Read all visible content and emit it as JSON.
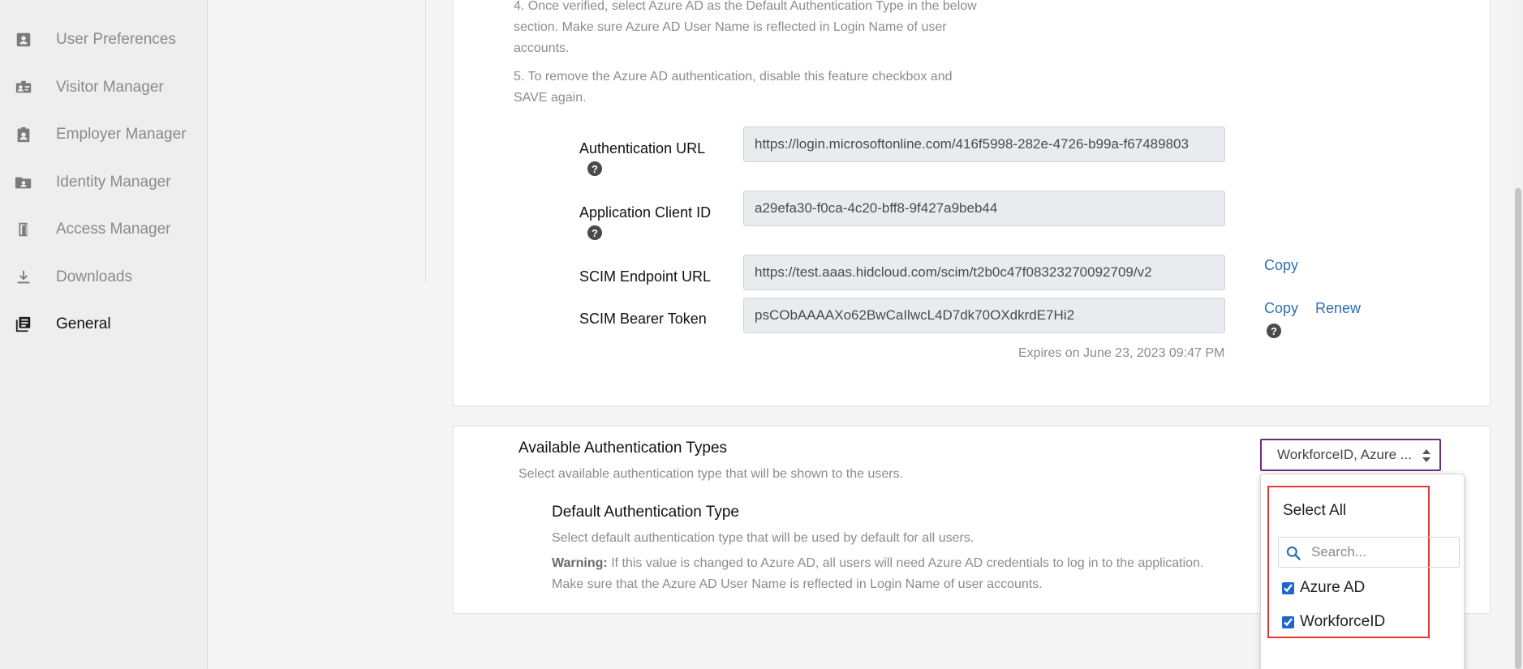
{
  "sidebar": {
    "items": [
      {
        "label": "User Preferences",
        "icon": "user-preferences-icon",
        "active": false
      },
      {
        "label": "Visitor Manager",
        "icon": "visitor-badge-icon",
        "active": false
      },
      {
        "label": "Employer Manager",
        "icon": "employer-badge-icon",
        "active": false
      },
      {
        "label": "Identity Manager",
        "icon": "identity-folder-icon",
        "active": false
      },
      {
        "label": "Access Manager",
        "icon": "door-icon",
        "active": false
      },
      {
        "label": "Downloads",
        "icon": "download-icon",
        "active": false
      },
      {
        "label": "General",
        "icon": "library-icon",
        "active": true
      }
    ]
  },
  "instructions": {
    "step4_line1": "4. Once verified, select Azure AD as the Default Authentication Type in the below",
    "step4_line2": "section. Make sure Azure AD User Name is reflected in Login Name of user",
    "step4_line3": "accounts.",
    "step5_line1": "5. To remove the Azure AD authentication, disable this feature checkbox and",
    "step5_line2": "SAVE again."
  },
  "fields": {
    "auth_url": {
      "label": "Authentication URL",
      "value": "https://login.microsoftonline.com/416f5998-282e-4726-b99a-f67489803"
    },
    "client_id": {
      "label": "Application Client ID",
      "value": "a29efa30-f0ca-4c20-bff8-9f427a9beb44"
    },
    "scim_url": {
      "label": "SCIM Endpoint URL",
      "value": "https://test.aaas.hidcloud.com/scim/t2b0c47f08323270092709/v2",
      "copy_label": "Copy"
    },
    "scim_token": {
      "label": "SCIM Bearer Token",
      "value": "psCObAAAAXo62BwCaIlwcL4D7dk70OXdkrdE7Hi2",
      "copy_label": "Copy",
      "renew_label": "Renew"
    },
    "expires": "Expires on June 23, 2023 09:47 PM",
    "help_glyph": "?"
  },
  "auth_types": {
    "title": "Available Authentication Types",
    "description": "Select available authentication type that will be shown to the users.",
    "selected_value": "WorkforceID, Azure ...",
    "dropdown": {
      "select_all_label": "Select All",
      "search_placeholder": "Search...",
      "options": [
        {
          "label": "Azure AD",
          "checked": true
        },
        {
          "label": "WorkforceID",
          "checked": true
        }
      ]
    }
  },
  "default_auth": {
    "title": "Default Authentication Type",
    "description": "Select default authentication type that will be used by default for all users.",
    "warning_label": "Warning:",
    "warning_text": "If this value is changed to Azure AD, all users will need Azure AD credentials to log in to the application.",
    "warning_text2": "Make sure that the Azure AD User Name is reflected in Login Name of user accounts."
  },
  "colors": {
    "link": "#2f6fb0",
    "select_border": "#6b2c7a",
    "highlight": "#e53935",
    "checkbox": "#1e66d0"
  }
}
